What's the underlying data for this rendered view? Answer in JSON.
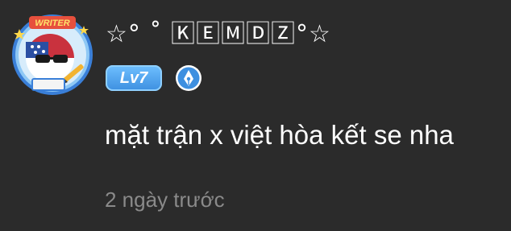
{
  "comment": {
    "author": {
      "username": "☆° ˚ 🄺🄴🄼🄳🅉°☆",
      "avatar_badge_text": "WRITER",
      "level_label": "Lv7"
    },
    "text": "mặt trận x việt hòa kết se nha",
    "timestamp": "2 ngày trước"
  },
  "colors": {
    "background": "#2b2b2b",
    "text": "#ffffff",
    "timestamp": "#8a8a8a",
    "level_badge": "#4fa3f0",
    "writer_badge": "#3d8fe0"
  },
  "icons": {
    "avatar": "avatar-with-writer-frame",
    "writer_badge": "pen-nib-icon"
  }
}
